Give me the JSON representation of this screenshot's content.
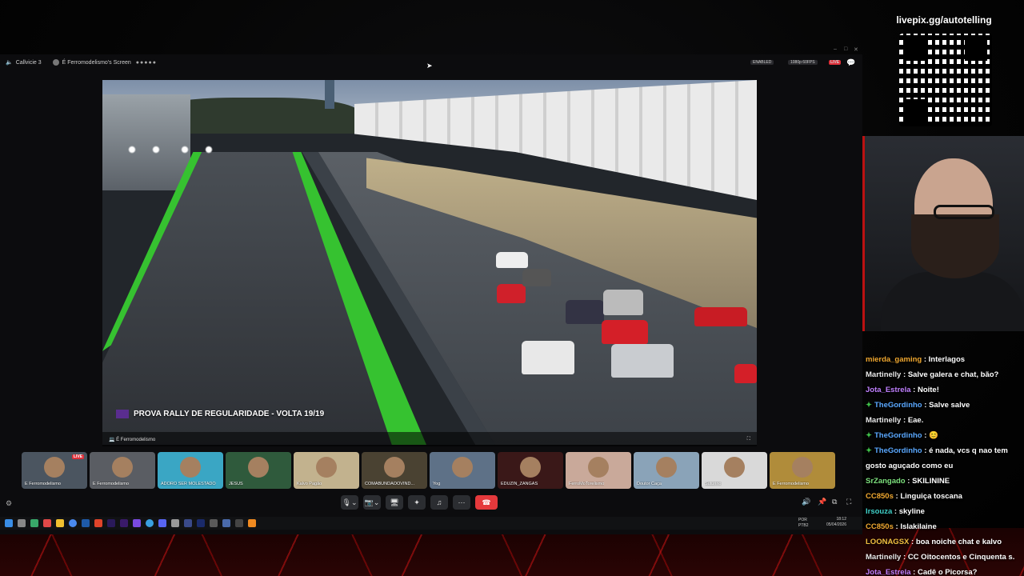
{
  "discord": {
    "voice_channel": "Callvicie 3",
    "screen_label": "É Ferromodelismo's Screen",
    "enabled_badge": "ENABLED",
    "quality_badge": "1080p 60FPS",
    "live_badge": "LIVE",
    "stream_caption": "PROVA RALLY DE REGULARIDADE  -  VOLTA 19/19",
    "stream_owner": "É Ferromodelismo",
    "participants": [
      {
        "name": "É Ferromodelismo",
        "live": "LIVE",
        "bg": "#4b5560"
      },
      {
        "name": "É Ferromodelismo",
        "bg": "#5a5d63"
      },
      {
        "name": "ADORO SER MOLESTADO",
        "bg": "#3aa6c4"
      },
      {
        "name": "JESUS",
        "bg": "#2f5a3c"
      },
      {
        "name": "Kalvo Pagão",
        "bg": "#c2b28e"
      },
      {
        "name": "COMABUNDAOOVIND...",
        "bg": "#4a4232"
      },
      {
        "name": "Yog",
        "bg": "#5e7187"
      },
      {
        "name": "EDUZIN_ZANGAS",
        "bg": "#3a1818"
      },
      {
        "name": "FerroMoTorelismo",
        "bg": "#c9a99a"
      },
      {
        "name": "Doutor Caça",
        "bg": "#8aa3b8"
      },
      {
        "name": "Suturino",
        "bg": "#d9d9d9"
      },
      {
        "name": "É Ferromodelismo",
        "bg": "#b08c3a"
      }
    ]
  },
  "overlay": {
    "qr_url": "livepix.gg/autotelling"
  },
  "taskbar": {
    "lang": "POR PTB2",
    "time": "18:12",
    "date": "05/04/2026"
  },
  "chat": [
    {
      "user": "mierda_gaming",
      "color": "#f0a830",
      "text": "Interlagos"
    },
    {
      "user": "Martinelly",
      "color": "#e8e8e8",
      "text": "Salve galera e chat, bão?"
    },
    {
      "user": "Jota_Estrela",
      "color": "#c080ff",
      "text": "Noite!"
    },
    {
      "user": "TheGordinho",
      "color": "#5aa8ff",
      "badge": true,
      "text": "Salve salve"
    },
    {
      "user": "Martinelly",
      "color": "#e8e8e8",
      "text": "Eae."
    },
    {
      "user": "TheGordinho",
      "color": "#5aa8ff",
      "badge": true,
      "text": "😊"
    },
    {
      "user": "TheGordinho",
      "color": "#5aa8ff",
      "badge": true,
      "text": "é nada, vcs q nao tem"
    },
    {
      "user": "",
      "color": "#e8e8e8",
      "text": "gosto aguçado como eu"
    },
    {
      "user": "SrZangado",
      "color": "#7de07d",
      "text": "SKILININE"
    },
    {
      "user": "CC850s",
      "color": "#f0a830",
      "text": "Linguiça toscana"
    },
    {
      "user": "Irsouza",
      "color": "#3fd0c8",
      "text": "skyline"
    },
    {
      "user": "CC850s",
      "color": "#f0a830",
      "text": "Islakilaine"
    },
    {
      "user": "LOONAGSX",
      "color": "#f0c040",
      "text": "boa noiche chat e kalvo"
    },
    {
      "user": "Martinelly",
      "color": "#e8e8e8",
      "text": "CC Oitocentos e Cinquenta s."
    },
    {
      "user": "Jota_Estrela",
      "color": "#c080ff",
      "text": "Cadê o Picorsa?"
    }
  ]
}
